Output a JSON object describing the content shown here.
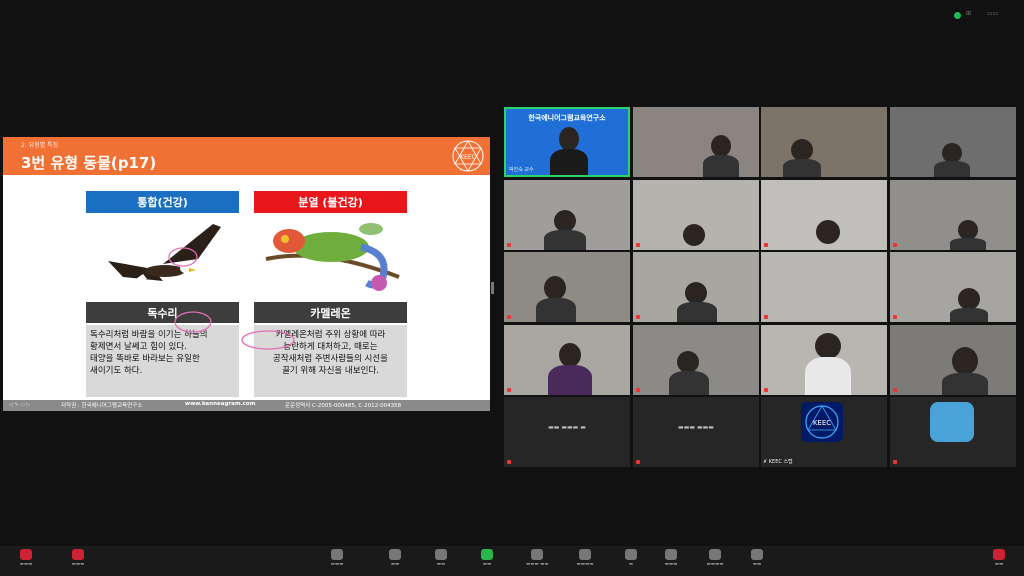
{
  "colors": {
    "slide_banner": "#f07133",
    "healthy": "#1b6fc2",
    "unhealthy": "#e9171c",
    "host_border": "#2cd36b"
  },
  "slide": {
    "section": "2. 유형별 특징",
    "title": "3번 유형 동물(p17)",
    "logo_text": "KEEC",
    "left": {
      "heading": "통합(건강)",
      "animal": "독수리",
      "desc_lines": [
        "독수리처럼 바람을 이기는 하늘의",
        "황제면서 날쎄고 힘이 있다.",
        "태양을 똑바로 바라보는 유일한",
        "새이기도 하다."
      ]
    },
    "right": {
      "heading": "분열 (불건강)",
      "animal": "카멜레온",
      "desc_lines": [
        "카멜레온처럼 주위 상황에 따라",
        "능란하게 대처하고, 때로는",
        "공작새처럼 주변사람들의 시선을",
        "끌기 위해 자신을 내보인다."
      ]
    },
    "footer": {
      "copyright": "저작권 : 한국에니어그램교육연구소",
      "website": "www.kenneagram.com",
      "registration": "운운정역사 C-2005-000485, C-2012-004358"
    }
  },
  "host": {
    "org": "한국에니어그램교육연구소",
    "name": "박진숙 교수"
  },
  "participants": {
    "keec_label": "KEEC 스텝",
    "keec_logo": "KEEC"
  }
}
